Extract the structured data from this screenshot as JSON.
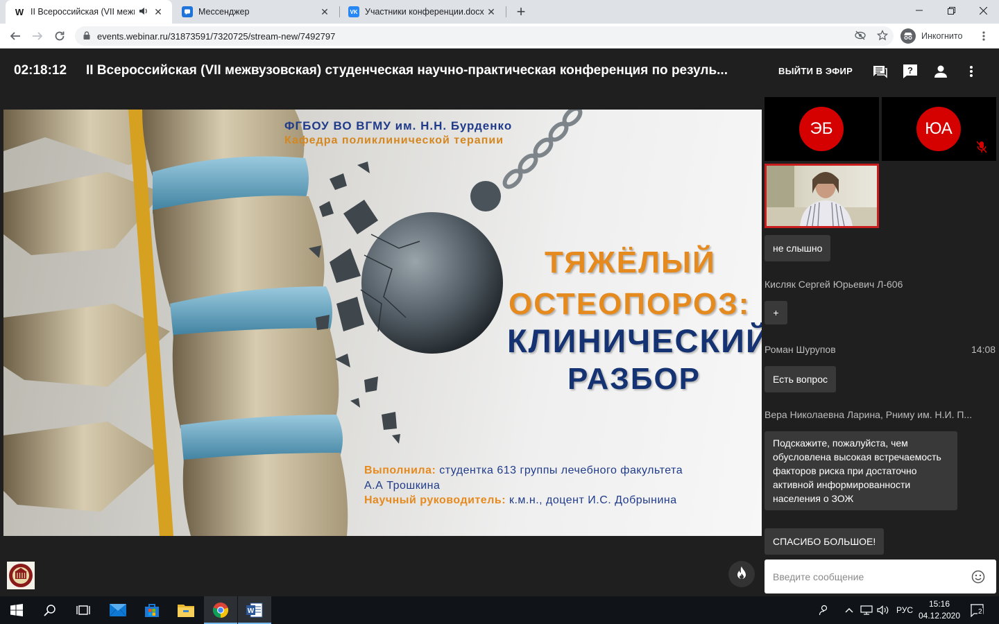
{
  "browser": {
    "tabs": [
      {
        "title": "II Всероссийская (VII межву",
        "favicon": "W",
        "active": true
      },
      {
        "title": "Мессенджер",
        "favicon": "messenger-icon",
        "active": false
      },
      {
        "title": "Участники конференции.docx",
        "favicon": "VK",
        "active": false
      }
    ],
    "url": "events.webinar.ru/31873591/7320725/stream-new/7492797",
    "incognito_label": "Инкогнито"
  },
  "header": {
    "timer": "02:18:12",
    "title": "II Всероссийская (VII межвузовская) студенческая научно-практическая конференция по резуль...",
    "go_live": "ВЫЙТИ В ЭФИР"
  },
  "slide": {
    "university": "ФГБОУ ВО ВГМУ им. Н.Н. Бурденко",
    "department": "Кафедра поликлинической терапии",
    "title_line1": "ТЯЖЁЛЫЙ",
    "title_line2": "ОСТЕОПОРОЗ:",
    "title_line3": "КЛИНИЧЕСКИЙ",
    "title_line4": "РАЗБОР",
    "performed_label": "Выполнила:",
    "performed_value": "студентка 613 группы лечебного факультета",
    "author": "А.А Трошкина",
    "supervisor_label": "Научный руководитель:",
    "supervisor_value": "к.м.н., доцент И.С. Добрынина"
  },
  "participants": [
    {
      "initials": "ЭБ",
      "muted": false
    },
    {
      "initials": "ЮА",
      "muted": true
    }
  ],
  "chat": {
    "messages": [
      {
        "text": "не слышно"
      },
      {
        "author": "Кисляк Сергей Юрьевич Л-606"
      },
      {
        "text": "+"
      },
      {
        "author": "Роман Шурупов",
        "time": "14:08"
      },
      {
        "text": "Есть вопрос"
      },
      {
        "author": "Вера Николаевна Ларина, Рниму им. Н.И. П..."
      },
      {
        "text": "Подскажите, пожалуйста, чем обусловлена высокая встречаемость факторов риска при достаточно активной информированности населения о ЗОЖ"
      },
      {
        "text": "СПАСИБО БОЛЬШОЕ!"
      }
    ],
    "input_placeholder": "Введите сообщение"
  },
  "taskbar": {
    "language": "РУС",
    "time": "15:16",
    "date": "04.12.2020",
    "notifications": "2"
  }
}
